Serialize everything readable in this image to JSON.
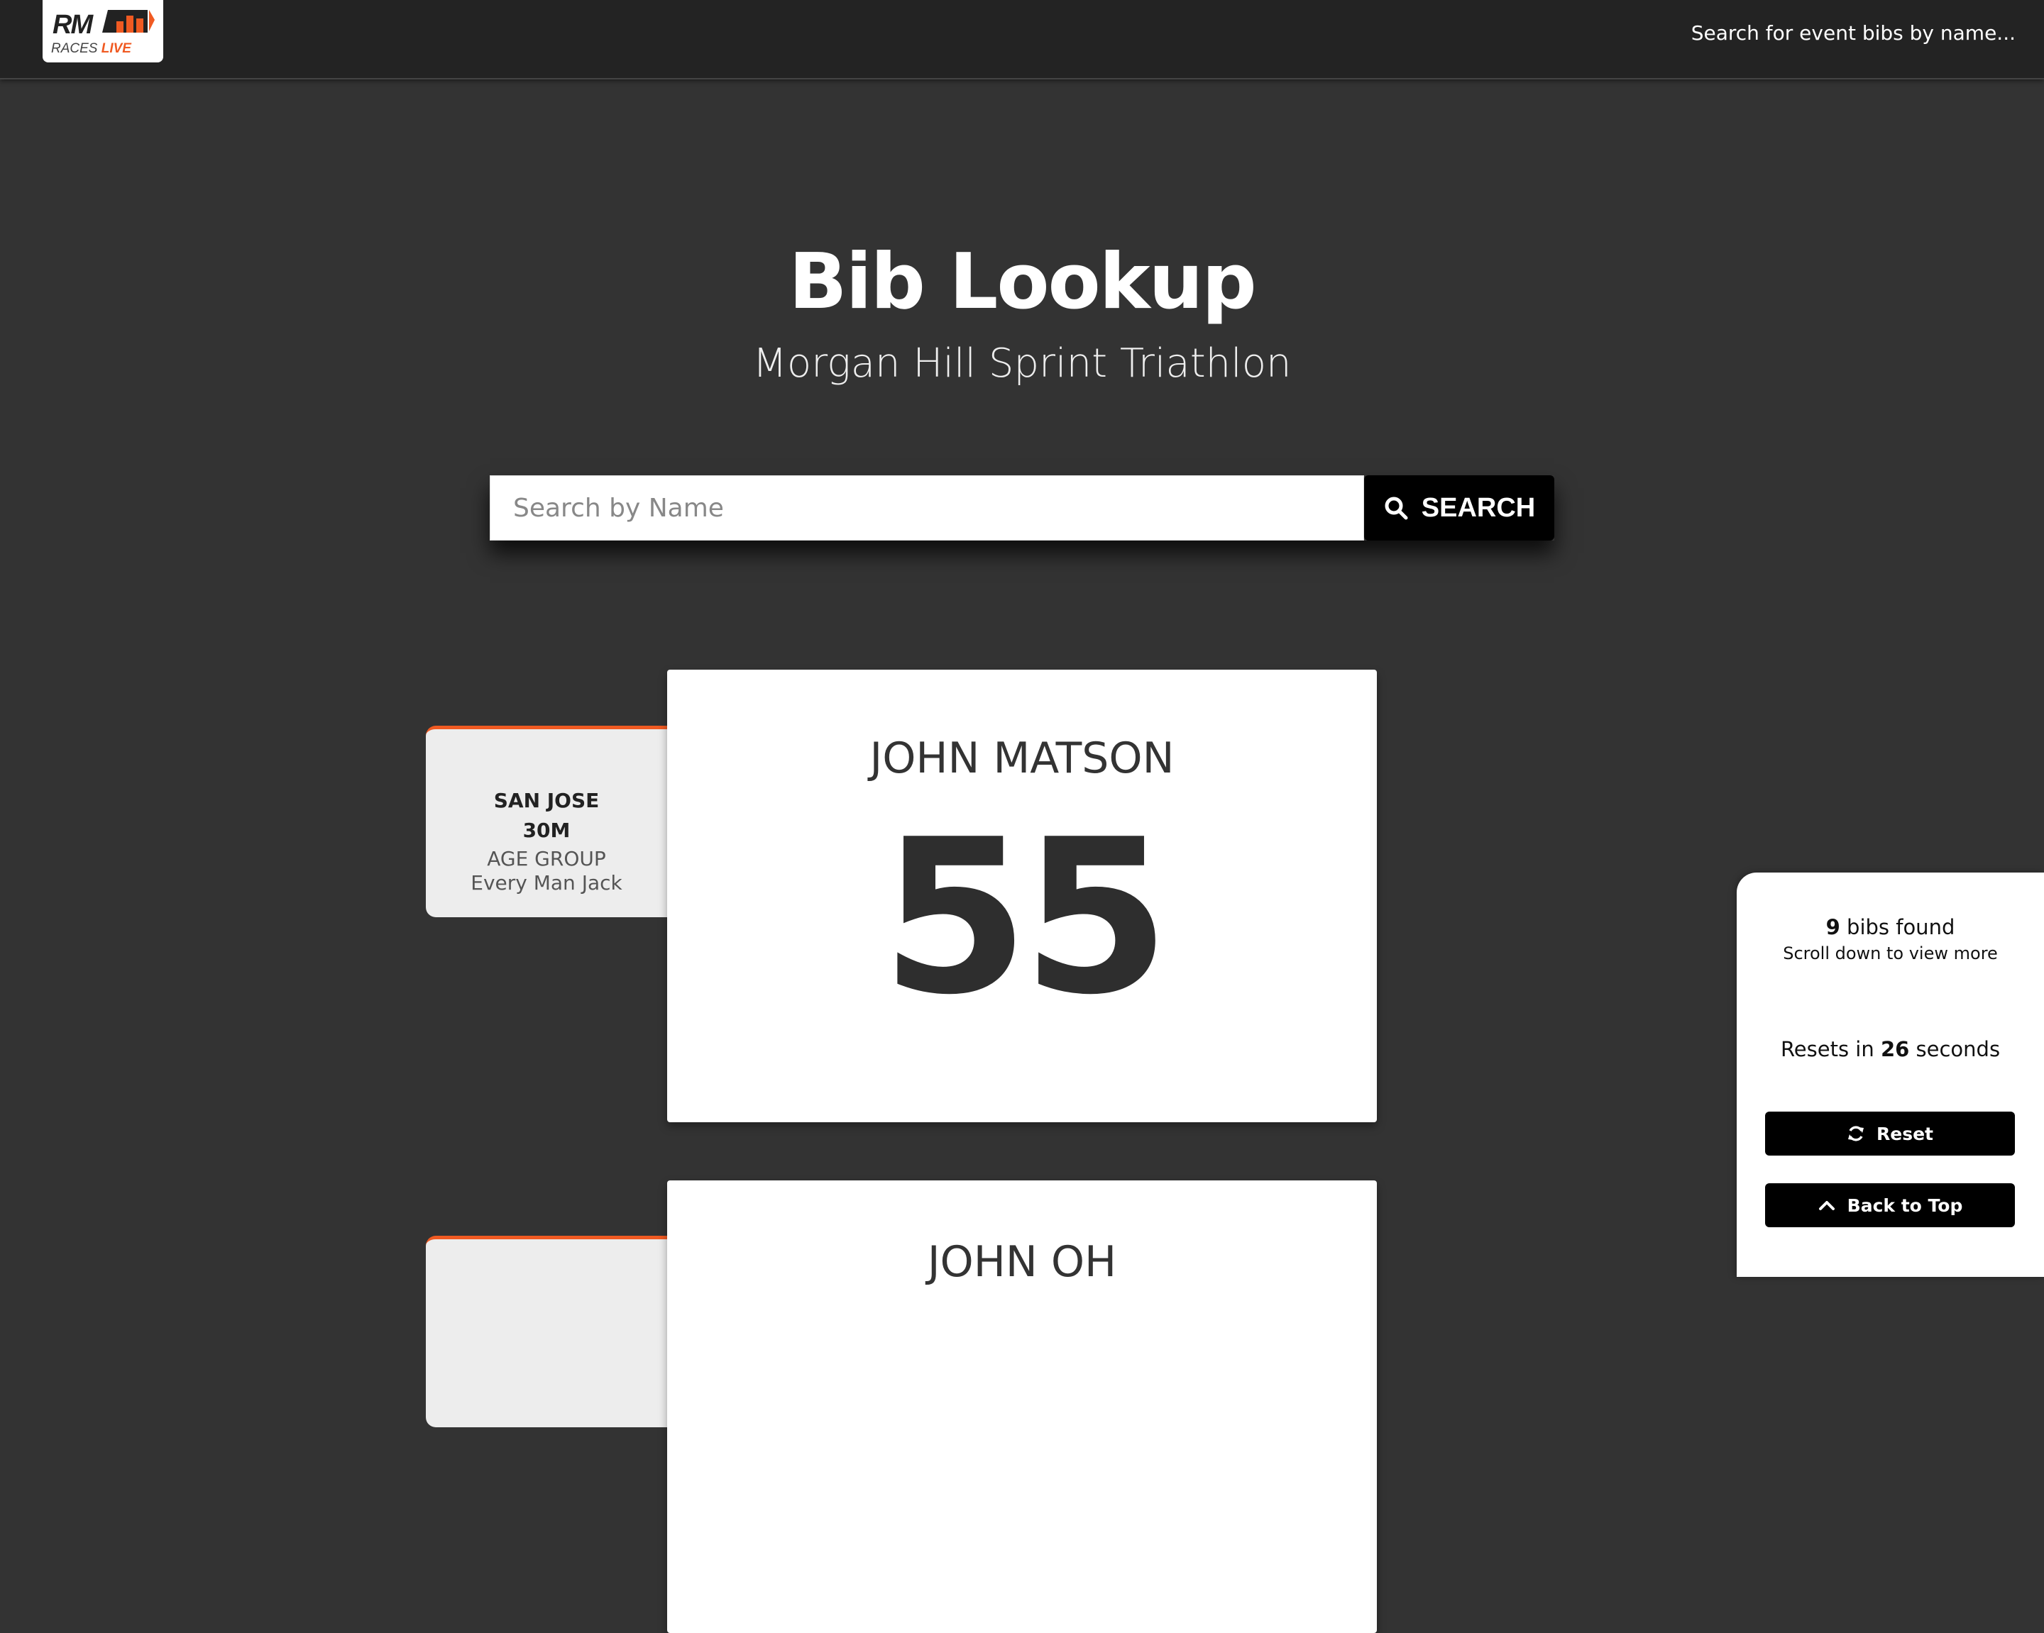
{
  "header": {
    "logo": {
      "mark": "RM",
      "sub_plain": "RACES",
      "sub_accent": "LIVE",
      "accent_color": "#f05a22"
    },
    "search_link": "Search for event bibs by name..."
  },
  "page": {
    "title": "Bib Lookup",
    "subtitle": "Morgan Hill Sprint Triathlon"
  },
  "search": {
    "placeholder": "Search by Name",
    "button_label": "SEARCH",
    "button_icon": "search-icon"
  },
  "results": [
    {
      "name": "JOHN MATSON",
      "bib": "55",
      "city": "SAN JOSE",
      "division": "30M",
      "group": "AGE GROUP",
      "team": "Every Man Jack"
    },
    {
      "name": "JOHN OH"
    }
  ],
  "panel": {
    "count": "9",
    "count_suffix": "bibs found",
    "hint": "Scroll down to view more",
    "resets_prefix": "Resets in",
    "resets_seconds": "26",
    "resets_suffix": "seconds",
    "reset_label": "Reset",
    "reset_icon": "refresh-icon",
    "back_label": "Back to Top",
    "back_icon": "chevron-up-icon"
  }
}
